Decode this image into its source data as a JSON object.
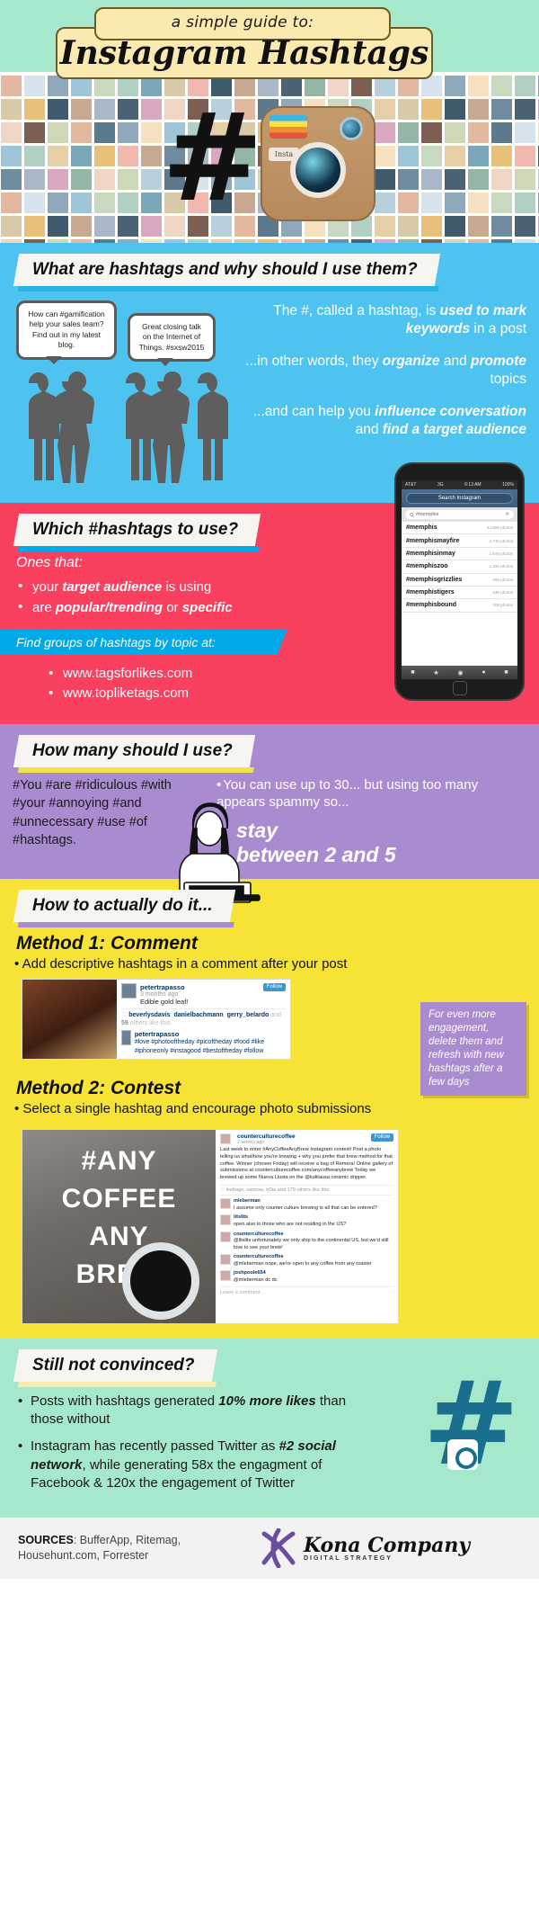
{
  "header": {
    "subtitle": "a simple guide to:",
    "title": "Instagram Hashtags",
    "hash_glyph": "#",
    "camera_badge": "Insta"
  },
  "section_what": {
    "heading": "What are hashtags and why should I use them?",
    "bubble_1": "How can #gamification help your sales team? Find out in my latest blog.",
    "bubble_2": "Great closing talk on the Internet of Things. #sxsw2015",
    "para_1_a": "The #, called a hashtag, is ",
    "para_1_b": "used to mark keywords",
    "para_1_c": " in a post",
    "para_2_a": "...in other words, they ",
    "para_2_b": "organize",
    "para_2_c": " and ",
    "para_2_d": "promote",
    "para_2_e": " topics",
    "para_3_a": "...and can help you ",
    "para_3_b": "influence conversation",
    "para_3_c": " and ",
    "para_3_d": "find a target audience"
  },
  "section_which": {
    "heading": "Which #hashtags to use?",
    "lead": "Ones that:",
    "bullets": [
      {
        "pre": "your ",
        "bold": "target audience",
        "post": " is using"
      },
      {
        "pre": "are ",
        "bold": "popular/trending",
        "post": " or ",
        "bold2": "specific"
      }
    ],
    "blue_bar": "Find groups of hashtags by topic at:",
    "links": [
      "www.tagsforlikes.com",
      "www.topliketags.com"
    ],
    "phone": {
      "carrier": "AT&T",
      "network": "3G",
      "time": "6:13 AM",
      "battery": "100%",
      "nav_label": "Search Instagram",
      "search_value": "#memphis",
      "search_icon": "search-icon",
      "clear_icon": "clear-icon",
      "results": [
        {
          "tag": "#memphis",
          "count": "44,559 photos"
        },
        {
          "tag": "#memphismayfire",
          "count": "4,740 photos"
        },
        {
          "tag": "#memphisinmay",
          "count": "1,549 photos"
        },
        {
          "tag": "#memphiszoo",
          "count": "1,436 photos"
        },
        {
          "tag": "#memphisgrizzlies",
          "count": "466 photos"
        },
        {
          "tag": "#memphistigers",
          "count": "435 photos"
        },
        {
          "tag": "#memphisbound",
          "count": "308 photos"
        }
      ],
      "tabs": [
        "home-icon",
        "star-icon",
        "camera-icon",
        "comment-icon",
        "profile-icon"
      ]
    }
  },
  "section_howmany": {
    "heading": "How many should I use?",
    "spam_text": "#You #are #ridiculous #with #your #annoying #and #unnecessary #use #of #hashtags.",
    "bullet": "You can use up to 30... but using too many appears spammy so...",
    "stay_line1": "stay",
    "stay_line2": "between 2 and 5"
  },
  "section_howto": {
    "heading": "How to actually do it...",
    "method1_title": "Method 1: Comment",
    "method1_bullet": "Add descriptive hashtags in a comment after your post",
    "post1": {
      "username": "petertrapasso",
      "time": "3 months ago",
      "caption": "Edible gold leaf!",
      "follow": "Follow",
      "likes_a": "beverlysdavis",
      "likes_b": "danielbachmann",
      "likes_c": "gerry_belardo",
      "likes_d": " and ",
      "likes_count": "59",
      "likes_e": " others like this.",
      "comment_user": "petertrapasso",
      "comment_tags": "#love #photooftheday #picoftheday #food #like #iphoneonly #instagood #bestoftheday #follow"
    },
    "note": "For even more engagement, delete them and refresh with new hashtags after a few days",
    "method2_title": "Method 2: Contest",
    "method2_bullet": "Select a single hashtag and encourage photo submissions",
    "post2": {
      "photo_words": [
        "#ANY",
        "COFFEE",
        "ANY",
        "BREW"
      ],
      "username": "counterculturecoffee",
      "time": "2 weeks ago",
      "follow": "Follow",
      "description": "Last week to enter #AnyCoffeeAnyBrew Instagram contest! Post a photo telling us what/how you're brewing + why you prefer that brew method for that coffee. Winner (chosen Friday) will receive a bag of Remera! Online gallery of submissions at counterculturecoffee.com/anycoffeeanybrew Today we brewed up some Nueva Llusta on the @kalitausa ceramic dripper.",
      "likers": "leebags, santvav, tr0ia and 179 others like this.",
      "comments": [
        {
          "user": "mleberman",
          "text": "I assume only counter culture brewing is all that can be entered?"
        },
        {
          "user": "litslits",
          "text": "open also to those who are not residing in the US?"
        },
        {
          "user": "counterculturecoffee",
          "text": "@litslits unfortunately we only ship to the continental US, but we'd still love to see your brew!"
        },
        {
          "user": "counterculturecoffee",
          "text": "@mleberman nope, we're open to any coffee from any roaster"
        },
        {
          "user": "joshpoole654",
          "text": "@mleberman dc dc"
        }
      ],
      "input_placeholder": "Leave a comment...",
      "more_icon": "more-icon"
    }
  },
  "section_convinced": {
    "heading": "Still not convinced?",
    "bullets": [
      {
        "pre": "Posts with hashtags generated ",
        "bold": "10% more likes",
        "post": " than those without"
      },
      {
        "pre": "Instagram has recently passed Twitter as ",
        "bold": "#2 social network",
        "post": ", while generating 58x the engagment of Facebook & 120x the engagement of Twitter"
      }
    ],
    "hash_glyph": "#"
  },
  "footer": {
    "sources_label": "SOURCES",
    "sources_text": ": BufferApp, Ritemag, Househunt.com, Forrester",
    "brand_name": "Kona Company",
    "brand_tagline": "DIGITAL STRATEGY"
  },
  "colors": {
    "mint": "#a5e8cb",
    "cream": "#fbeab0",
    "blue": "#4ec3f0",
    "pink": "#f9405f",
    "purple": "#a98cd0",
    "yellow": "#f7e335",
    "teal": "#1a6e8e"
  }
}
